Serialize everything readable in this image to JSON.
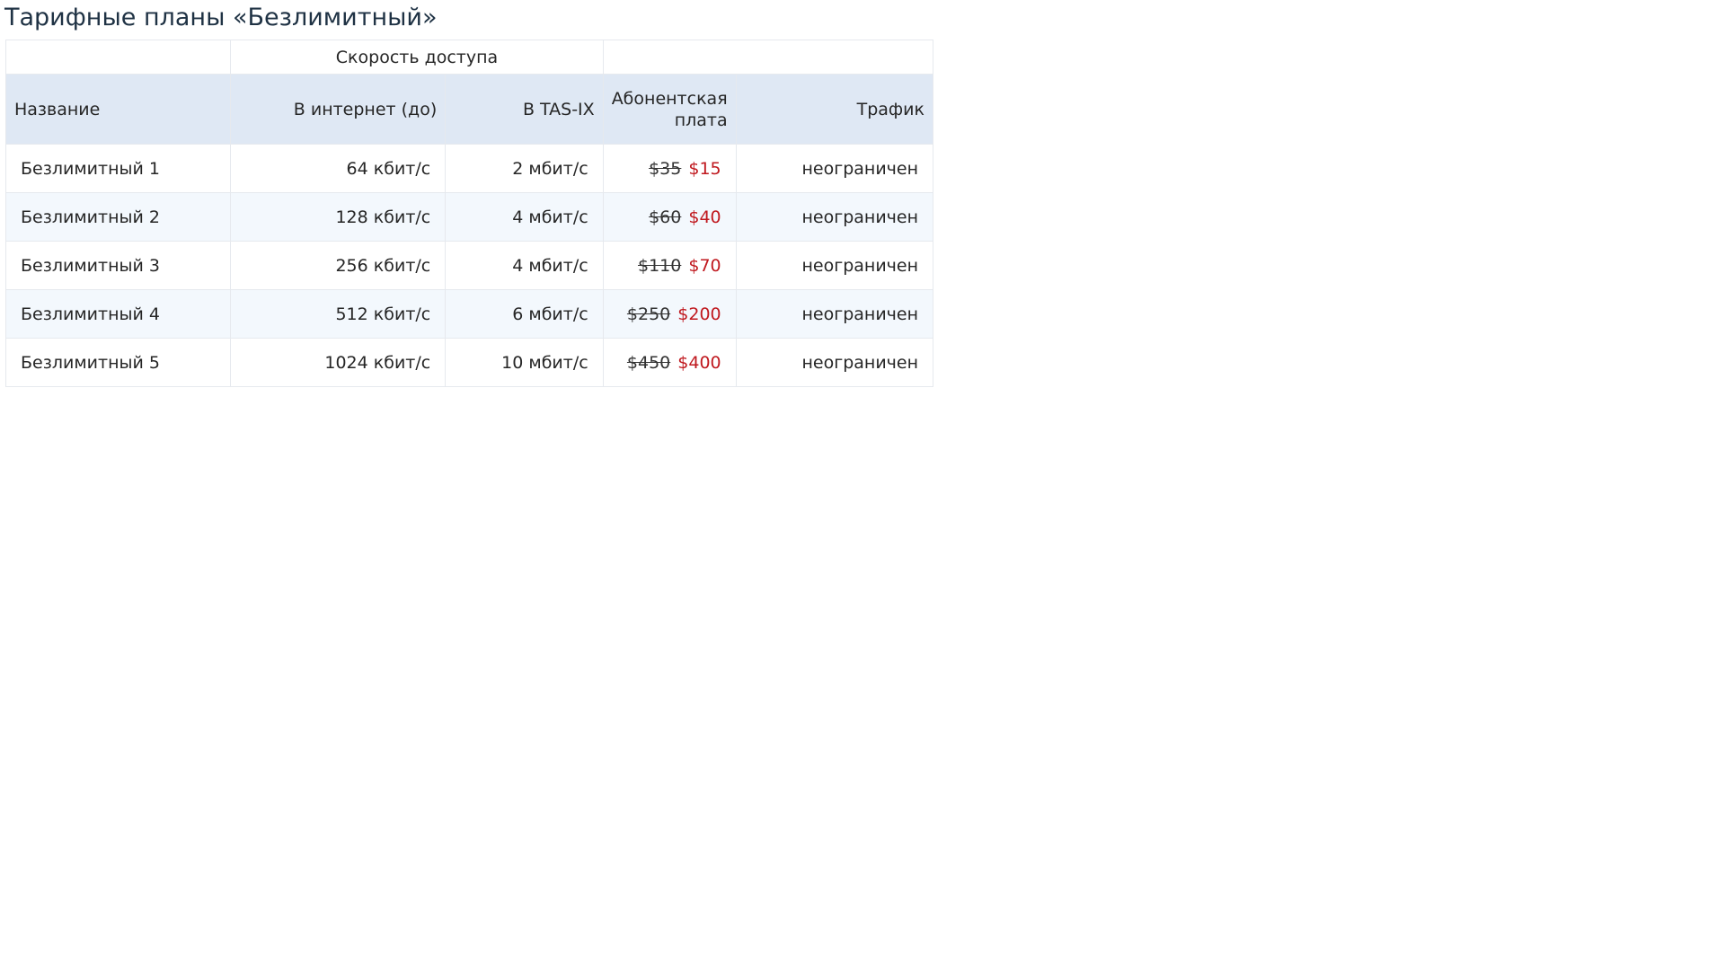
{
  "page": {
    "title": "Тарифные планы «Безлимитный»"
  },
  "table": {
    "group_header": "Скорость доступа",
    "columns": {
      "name": "Название",
      "internet": "В интернет (до)",
      "tasix": "В TAS-IX",
      "fee": "Абонентская плата",
      "traffic": "Трафик"
    },
    "rows": [
      {
        "name": "Безлимитный 1",
        "internet": "64 кбит/с",
        "tasix": "2 мбит/с",
        "old_price": "$35",
        "new_price": "$15",
        "traffic": "неограничен"
      },
      {
        "name": "Безлимитный 2",
        "internet": "128 кбит/с",
        "tasix": "4 мбит/с",
        "old_price": "$60",
        "new_price": "$40",
        "traffic": "неограничен"
      },
      {
        "name": "Безлимитный 3",
        "internet": "256 кбит/с",
        "tasix": "4 мбит/с",
        "old_price": "$110",
        "new_price": "$70",
        "traffic": "неограничен"
      },
      {
        "name": "Безлимитный 4",
        "internet": "512 кбит/с",
        "tasix": "6 мбит/с",
        "old_price": "$250",
        "new_price": "$200",
        "traffic": "неограничен"
      },
      {
        "name": "Безлимитный 5",
        "internet": "1024 кбит/с",
        "tasix": "10 мбит/с",
        "old_price": "$450",
        "new_price": "$400",
        "traffic": "неограничен"
      }
    ]
  },
  "colors": {
    "header_background": "#dfe8f4",
    "stripe_background": "#f3f8fd",
    "new_price": "#c0191f",
    "border": "#e6e9ee",
    "title": "#1f3244"
  }
}
